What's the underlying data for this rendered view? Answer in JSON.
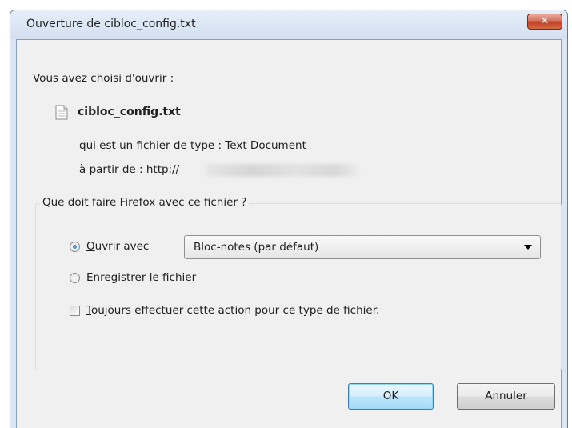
{
  "window": {
    "title": "Ouverture de cibloc_config.txt",
    "close_label": "✕"
  },
  "intro": {
    "heading": "Vous avez choisi d'ouvrir :",
    "file_icon": "text-file-icon",
    "filename": "cibloc_config.txt",
    "type_line": "qui est un fichier de type : Text Document",
    "source_prefix": "à partir de : http://"
  },
  "action_group": {
    "legend": "Que doit faire Firefox avec ce fichier ?",
    "open_with": {
      "selected": true,
      "accel": "O",
      "label_rest": "uvrir avec",
      "select_value": "Bloc-notes (par défaut)"
    },
    "save_file": {
      "selected": false,
      "accel": "E",
      "label_rest": "nregistrer le fichier"
    },
    "always": {
      "checked": false,
      "accel": "T",
      "label_rest": "oujours effectuer cette action pour ce type de fichier."
    }
  },
  "buttons": {
    "ok": "OK",
    "cancel": "Annuler"
  },
  "colors": {
    "accent": "#3c7fb1",
    "close": "#c13e22",
    "dialog_bg": "#f0f0f0"
  }
}
